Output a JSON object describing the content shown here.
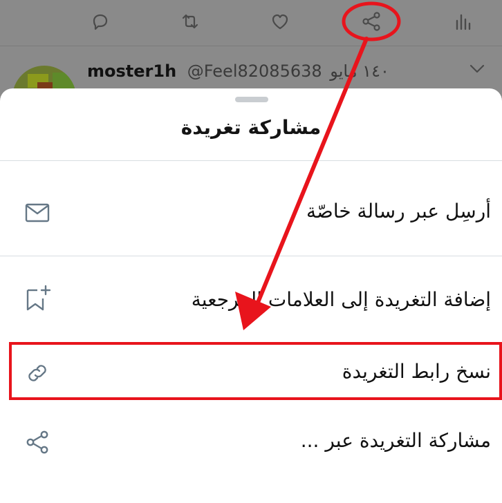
{
  "background_tweet": {
    "author_name": "moster1h",
    "author_handle": "@Feel82085638",
    "date": "١٤٠ مايو"
  },
  "action_bar": {
    "icons": [
      "reply-icon",
      "retweet-icon",
      "like-icon",
      "share-icon",
      "analytics-icon"
    ]
  },
  "share_sheet": {
    "title": "مشاركة تغريدة",
    "items": [
      {
        "label": "أرسِل عبر رسالة خاصّة",
        "icon": "envelope-icon"
      },
      {
        "label": "إضافة التغريدة إلى العلامات المرجعية",
        "icon": "bookmark-add-icon"
      },
      {
        "label": "نسخ رابط التغريدة",
        "icon": "link-icon"
      },
      {
        "label": "مشاركة التغريدة عبر ...",
        "icon": "share-icon"
      }
    ]
  },
  "colors": {
    "annotation": "#e8141c",
    "backdrop": "#8a8a8a",
    "icon_gray": "#657786"
  }
}
